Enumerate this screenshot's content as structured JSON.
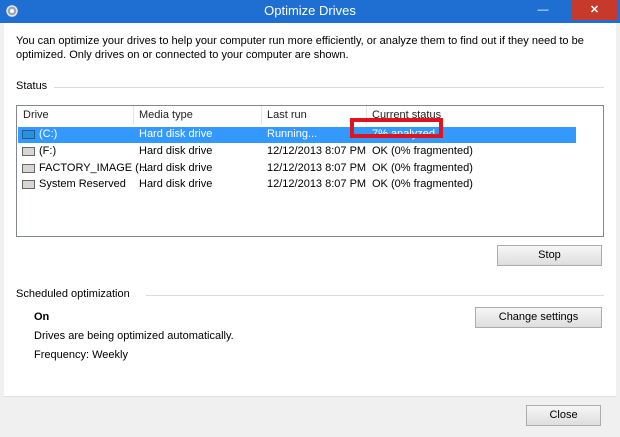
{
  "window": {
    "title": "Optimize Drives",
    "minimize_icon": "minimize-icon",
    "maximize_icon": "maximize-icon",
    "close_icon": "close-icon"
  },
  "intro": "You can optimize your drives to help your computer run more efficiently, or analyze them to find out if they need to be optimized. Only drives on or connected to your computer are shown.",
  "status_section": {
    "label": "Status"
  },
  "table": {
    "columns": [
      "Drive",
      "Media type",
      "Last run",
      "Current status"
    ],
    "rows": [
      {
        "drive": "(C:)",
        "media": "Hard disk drive",
        "last_run": "Running...",
        "status": "7% analyzed",
        "icon": "windows-drive-icon",
        "selected": true
      },
      {
        "drive": "(F:)",
        "media": "Hard disk drive",
        "last_run": "12/12/2013 8:07 PM",
        "status": "OK (0% fragmented)",
        "icon": "hard-drive-icon",
        "selected": false
      },
      {
        "drive": "FACTORY_IMAGE (...",
        "media": "Hard disk drive",
        "last_run": "12/12/2013 8:07 PM",
        "status": "OK (0% fragmented)",
        "icon": "hard-drive-icon",
        "selected": false
      },
      {
        "drive": "System Reserved",
        "media": "Hard disk drive",
        "last_run": "12/12/2013 8:07 PM",
        "status": "OK (0% fragmented)",
        "icon": "hard-drive-icon",
        "selected": false
      }
    ]
  },
  "buttons": {
    "stop": "Stop",
    "change_settings": "Change settings",
    "close": "Close"
  },
  "scheduled": {
    "label": "Scheduled optimization",
    "state": "On",
    "description": "Drives are being optimized automatically.",
    "frequency": "Frequency: Weekly"
  },
  "colors": {
    "titlebar": "#1f6fd2",
    "selection": "#3399ff",
    "highlight": "#e0141e",
    "close_button": "#c7392a"
  }
}
